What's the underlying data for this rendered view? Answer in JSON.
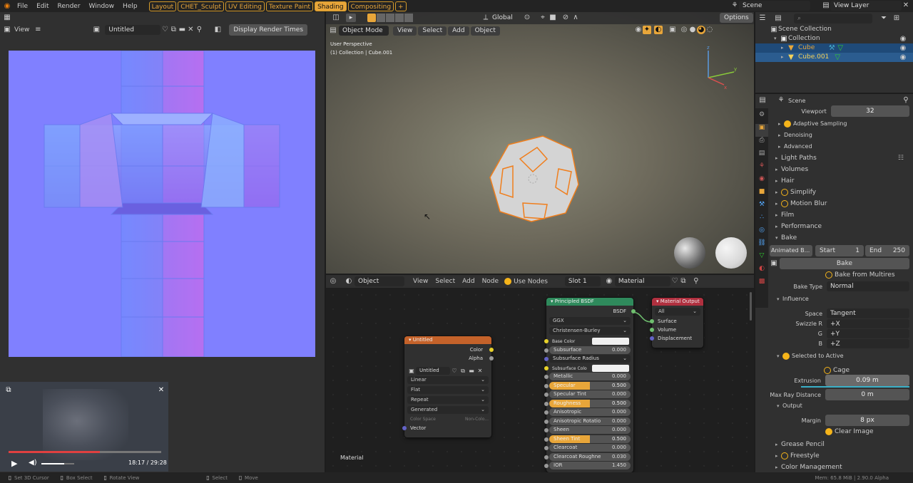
{
  "menu": {
    "file": "File",
    "edit": "Edit",
    "render": "Render",
    "window": "Window",
    "help": "Help"
  },
  "workspaces": [
    "Layout",
    "CHET_Sculpt",
    "UV Editing",
    "Texture Paint",
    "Shading",
    "Compositing"
  ],
  "workspace_active": "Shading",
  "workspace_add": "+",
  "scene": {
    "name": "Scene",
    "view_layer": "View Layer"
  },
  "image_editor": {
    "view": "View",
    "image_name": "Untitled",
    "display_render_times": "Display Render Times"
  },
  "video": {
    "time": "18:17 / 29:28",
    "progress": 0.6,
    "volume": 0.7
  },
  "viewport": {
    "mode": "Object Mode",
    "menus": [
      "View",
      "Select",
      "Add",
      "Object"
    ],
    "transform": "Global",
    "options": "Options",
    "perspective": "User Perspective",
    "collection_info": "(1) Collection | Cube.001"
  },
  "node_editor": {
    "type": "Object",
    "menus": [
      "View",
      "Select",
      "Add",
      "Node"
    ],
    "use_nodes": "Use Nodes",
    "slot": "Slot 1",
    "material": "Material",
    "footer_label": "Material"
  },
  "image_node": {
    "title": "Untitled",
    "out_color": "Color",
    "out_alpha": "Alpha",
    "image": "Untitled",
    "interp": "Linear",
    "proj": "Flat",
    "ext": "Repeat",
    "source": "Generated",
    "color_space_label": "Color Space",
    "color_space_value": "Non-Colo...",
    "in_vector": "Vector"
  },
  "bsdf_node": {
    "title": "Principled BSDF",
    "out": "BSDF",
    "dist": "GGX",
    "sss_method": "Christensen-Burley",
    "rows": [
      {
        "label": "Base Color",
        "type": "color"
      },
      {
        "label": "Subsurface",
        "value": "0.000",
        "type": "pill"
      },
      {
        "label": "Subsurface Radius",
        "type": "select"
      },
      {
        "label": "Subsurface Colo",
        "type": "color"
      },
      {
        "label": "Metallic",
        "value": "0.000",
        "type": "pill"
      },
      {
        "label": "Specular",
        "value": "0.500",
        "type": "half"
      },
      {
        "label": "Specular Tint",
        "value": "0.000",
        "type": "pill"
      },
      {
        "label": "Roughness",
        "value": "0.500",
        "type": "half"
      },
      {
        "label": "Anisotropic",
        "value": "0.000",
        "type": "pill"
      },
      {
        "label": "Anisotropic Rotatio",
        "value": "0.000",
        "type": "pill"
      },
      {
        "label": "Sheen",
        "value": "0.000",
        "type": "pill"
      },
      {
        "label": "Sheen Tint",
        "value": "0.500",
        "type": "half"
      },
      {
        "label": "Clearcoat",
        "value": "0.000",
        "type": "pill"
      },
      {
        "label": "Clearcoat Roughne",
        "value": "0.030",
        "type": "pill"
      },
      {
        "label": "IOR",
        "value": "1.450",
        "type": "pill"
      }
    ]
  },
  "output_node": {
    "title": "Material Output",
    "target": "All",
    "inputs": [
      "Surface",
      "Volume",
      "Displacement"
    ]
  },
  "outliner": {
    "scene_collection": "Scene Collection",
    "collection": "Collection",
    "items": [
      "Cube",
      "Cube.001"
    ]
  },
  "props": {
    "context": "Scene",
    "viewport_label": "Viewport",
    "viewport_value": "32",
    "adaptive_sampling": "Adaptive Sampling",
    "denoising": "Denoising",
    "advanced": "Advanced",
    "light_paths": "Light Paths",
    "volumes": "Volumes",
    "hair": "Hair",
    "simplify": "Simplify",
    "motion_blur": "Motion Blur",
    "film": "Film",
    "performance": "Performance",
    "bake": "Bake",
    "animated_bake": "Animated B...",
    "start_label": "Start",
    "start_value": "1",
    "end_label": "End",
    "end_value": "250",
    "bake_button": "Bake",
    "bake_from_multires": "Bake from Multires",
    "bake_type_label": "Bake Type",
    "bake_type_value": "Normal",
    "influence": "Influence",
    "space_label": "Space",
    "space_value": "Tangent",
    "swizzle_r_label": "Swizzle R",
    "swizzle_r": "+X",
    "g_label": "G",
    "swizzle_g": "+Y",
    "b_label": "B",
    "swizzle_b": "+Z",
    "selected_to_active": "Selected to Active",
    "cage": "Cage",
    "extrusion_label": "Extrusion",
    "extrusion_value": "0.09 m",
    "max_ray_label": "Max Ray Distance",
    "max_ray_value": "0 m",
    "output": "Output",
    "margin_label": "Margin",
    "margin_value": "8 px",
    "clear_image": "Clear Image",
    "grease_pencil": "Grease Pencil",
    "freestyle": "Freestyle",
    "color_management": "Color Management"
  },
  "status": {
    "left": [
      "Set 3D Cursor",
      "Box Select",
      "Rotate View"
    ],
    "select": "Select",
    "move": "Move",
    "right": "Mem: 65.8 MiB | 2.90.0 Alpha"
  },
  "colors": {
    "accent": "#e8a63a",
    "normal_map": "#8080ff",
    "bsdf_header": "#2f8a5c",
    "output_header": "#b0303f",
    "texture_header": "#c4622a",
    "select_blue": "#1f4a78"
  }
}
